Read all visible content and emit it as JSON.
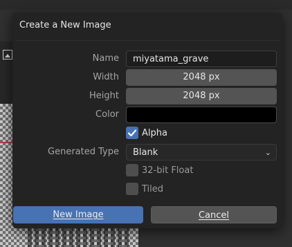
{
  "dialog": {
    "title": "Create a New Image"
  },
  "form": {
    "name_label": "Name",
    "name_value": "miyatama_grave",
    "width_label": "Width",
    "width_value": "2048 px",
    "height_label": "Height",
    "height_value": "2048 px",
    "color_label": "Color",
    "color_value": "#000000",
    "alpha_label": "Alpha",
    "alpha_checked": true,
    "generated_type_label": "Generated Type",
    "generated_type_value": "Blank",
    "float_label": "32-bit Float",
    "float_checked": false,
    "tiled_label": "Tiled",
    "tiled_checked": false
  },
  "buttons": {
    "confirm_label": "New Image",
    "cancel_label": "Cancel"
  },
  "colors": {
    "accent": "#4772b3",
    "dialog_bg": "#232323",
    "number_field_bg": "#545454"
  }
}
